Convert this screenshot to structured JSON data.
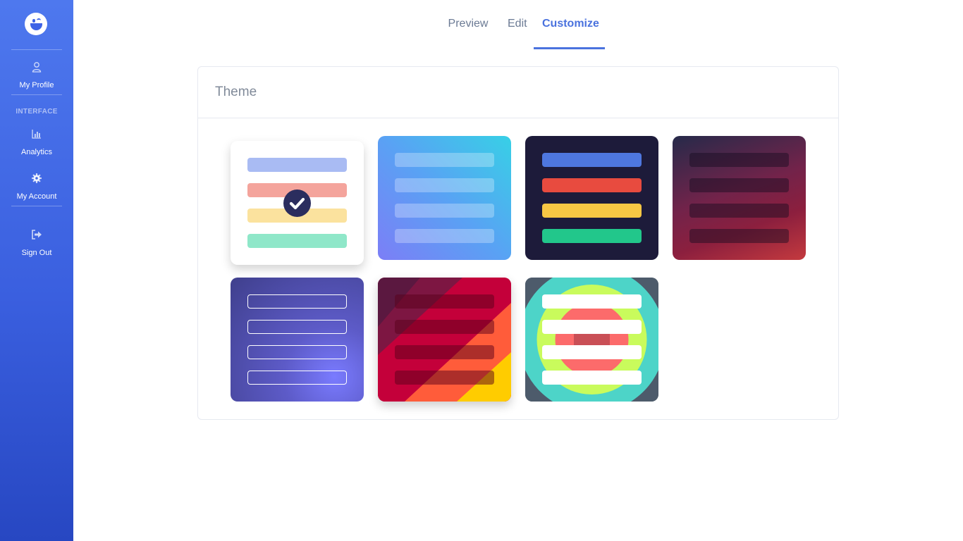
{
  "sidebar": {
    "items": [
      {
        "label": "My Profile",
        "icon": "user-icon"
      },
      {
        "label": "Analytics",
        "icon": "bar-chart-icon"
      },
      {
        "label": "My Account",
        "icon": "gear-icon"
      },
      {
        "label": "Sign Out",
        "icon": "sign-out-icon"
      }
    ],
    "section_label": "INTERFACE"
  },
  "tabs": [
    {
      "label": "Preview"
    },
    {
      "label": "Edit"
    },
    {
      "label": "Customize",
      "active": true
    }
  ],
  "card": {
    "title": "Theme"
  },
  "themes": [
    {
      "name": "light",
      "selected": true,
      "colors": [
        "#a9bbf3",
        "#f4a49c",
        "#fbe29e",
        "#8fe7c9"
      ]
    },
    {
      "name": "sky-gradient",
      "selected": false,
      "colors": [
        "#37d0e6",
        "#7c7ef6"
      ]
    },
    {
      "name": "dark-navy",
      "selected": false,
      "colors": [
        "#4e77df",
        "#e84b3f",
        "#f7c744",
        "#22c78b"
      ]
    },
    {
      "name": "crimson-gradient",
      "selected": false,
      "colors": [
        "#262a4a",
        "#c43a3e"
      ]
    },
    {
      "name": "indigo-outline",
      "selected": false,
      "colors": [
        "#3f3f8c",
        "#7a7bff"
      ]
    },
    {
      "name": "sunset-stripes",
      "selected": false,
      "colors": [
        "#c4003a",
        "#ff6d2e",
        "#ffcc00"
      ]
    },
    {
      "name": "retro-circles",
      "selected": false,
      "colors": [
        "#4dd4c8",
        "#c9fb5c",
        "#fc6b6b"
      ]
    }
  ],
  "colors": {
    "accent": "#4a72de",
    "sidebar_top": "#4e78ee",
    "sidebar_bottom": "#2747c2"
  }
}
